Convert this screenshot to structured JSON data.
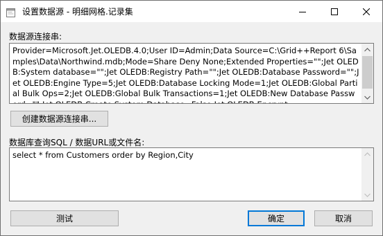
{
  "window": {
    "title": "设置数据源 - 明细网格.记录集",
    "icon": "window-app-icon",
    "controls": {
      "minimize": "minimize-icon",
      "maximize": "maximize-icon",
      "close": "close-icon"
    }
  },
  "connection": {
    "label": "数据源连接串:",
    "value": "Provider=Microsoft.Jet.OLEDB.4.0;User ID=Admin;Data Source=C:\\Grid++Report 6\\Samples\\Data\\Northwind.mdb;Mode=Share Deny None;Extended Properties=\"\";Jet OLEDB:System database=\"\";Jet OLEDB:Registry Path=\"\";Jet OLEDB:Database Password=\"\";Jet OLEDB:Engine Type=5;Jet OLEDB:Database Locking Mode=1;Jet OLEDB:Global Partial Bulk Ops=2;Jet OLEDB:Global Bulk Transactions=1;Jet OLEDB:New Database Password=\"\";Jet OLEDB:Create System Database=False;Jet OLEDB:Encrypt",
    "build_button": "创建数据源连接串..."
  },
  "query": {
    "label": "数据库查询SQL / 数据URL或文件名:",
    "value": "select * from Customers order by Region,City"
  },
  "buttons": {
    "test": "测试",
    "ok": "确定",
    "cancel": "取消"
  },
  "colors": {
    "accent": "#0078d7",
    "dialog_bg": "#f0f0f0",
    "button_bg": "#e1e1e1"
  }
}
